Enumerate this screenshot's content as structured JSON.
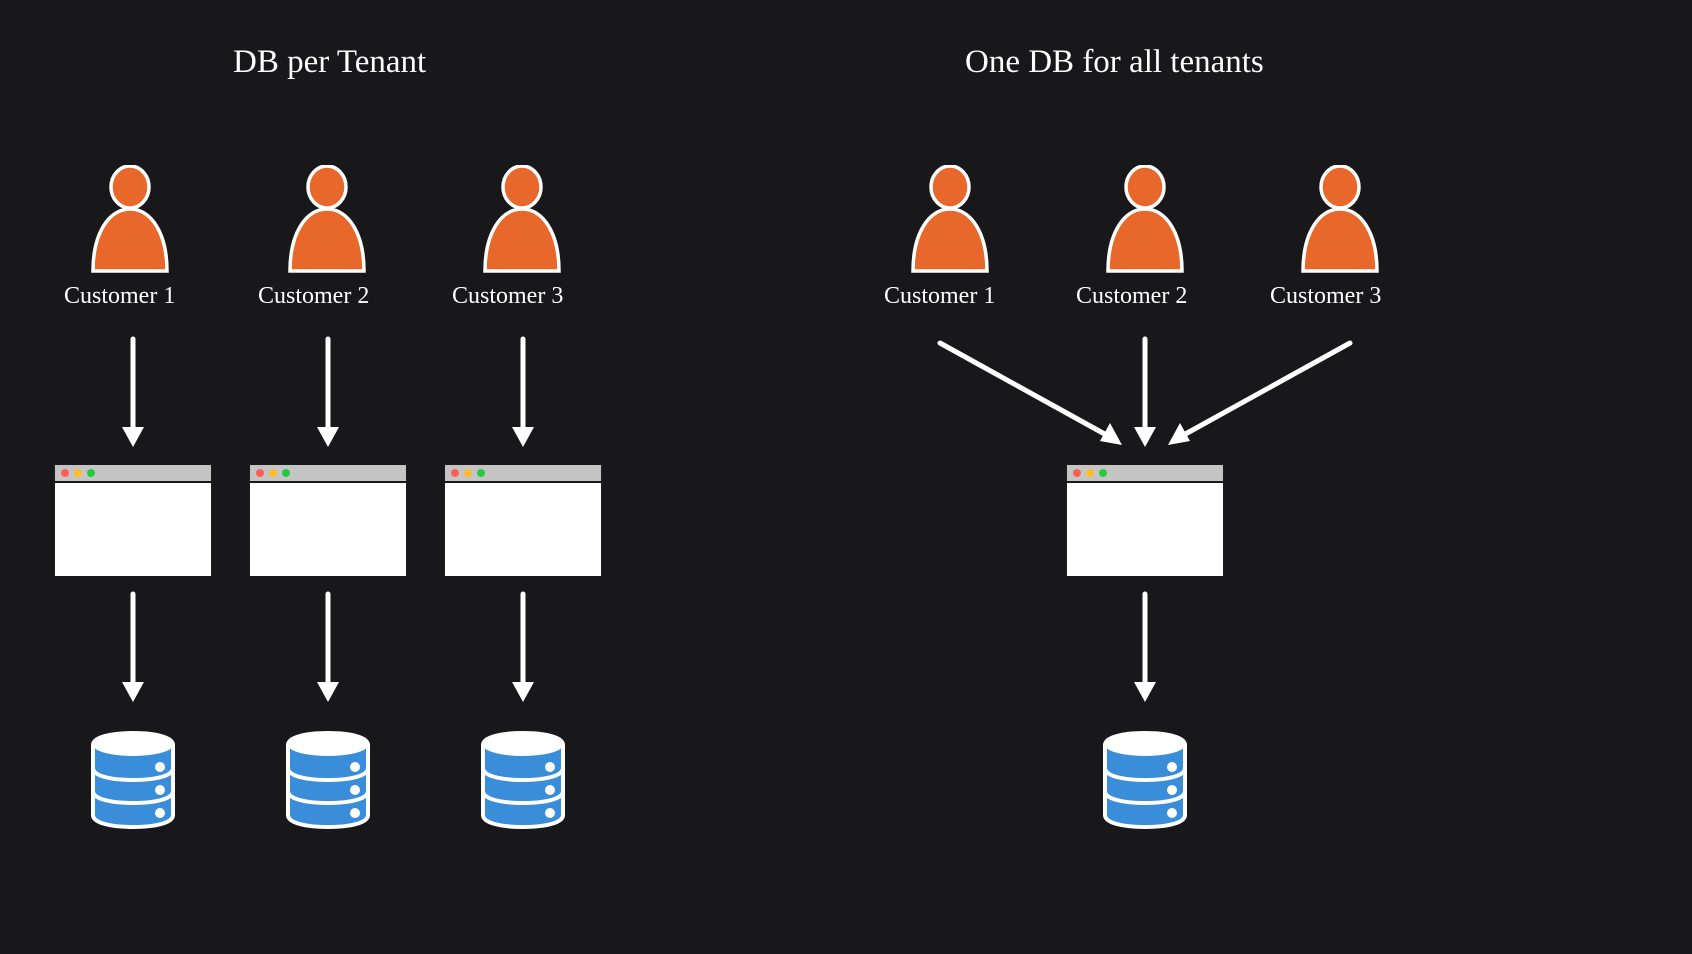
{
  "left": {
    "title": "DB per Tenant",
    "customers": [
      {
        "label": "Customer 1"
      },
      {
        "label": "Customer 2"
      },
      {
        "label": "Customer 3"
      }
    ]
  },
  "right": {
    "title": "One DB for all tenants",
    "customers": [
      {
        "label": "Customer 1"
      },
      {
        "label": "Customer 2"
      },
      {
        "label": "Customer 3"
      }
    ]
  },
  "colors": {
    "person": "#e8682c",
    "db": "#3a8dd8",
    "stroke": "#ffffff",
    "bg": "#18171a"
  }
}
